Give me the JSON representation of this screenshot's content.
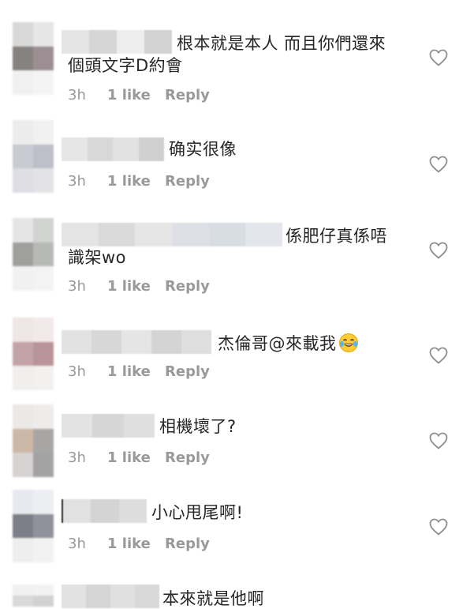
{
  "comments": [
    {
      "text_line1": "根本就是本人 而且你們還來",
      "text_line2": "個頭文字D約會",
      "time": "3h",
      "likes": "1 like",
      "reply": "Reply"
    },
    {
      "text_line1": "确实很像",
      "time": "3h",
      "likes": "1 like",
      "reply": "Reply"
    },
    {
      "text_line1": "係肥仔真係唔",
      "text_line2": "識架wo",
      "time": "3h",
      "likes": "1 like",
      "reply": "Reply"
    },
    {
      "text_line1": "杰倫哥@來載我",
      "emoji": "face-with-tears-of-joy-emoji",
      "time": "3h",
      "likes": "1 like",
      "reply": "Reply"
    },
    {
      "text_line1": "相機壞了?",
      "time": "3h",
      "likes": "1 like",
      "reply": "Reply"
    },
    {
      "text_line1": "小心甩尾啊!",
      "time": "3h",
      "likes": "1 like",
      "reply": "Reply"
    },
    {
      "text_line1": "本來就是他啊"
    }
  ],
  "icons": {
    "like": "heart-outline-icon"
  },
  "colors": {
    "text": "#262626",
    "meta": "#999999",
    "heart": "#8e8e8e"
  }
}
